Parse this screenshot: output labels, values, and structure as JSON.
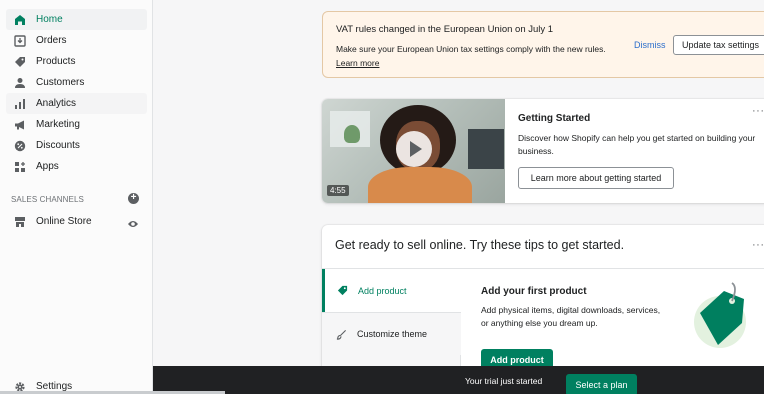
{
  "sidebar": {
    "items": [
      {
        "label": "Home",
        "icon": "home-icon"
      },
      {
        "label": "Orders",
        "icon": "orders-icon"
      },
      {
        "label": "Products",
        "icon": "tag-icon"
      },
      {
        "label": "Customers",
        "icon": "person-icon"
      },
      {
        "label": "Analytics",
        "icon": "bar-chart-icon"
      },
      {
        "label": "Marketing",
        "icon": "megaphone-icon"
      },
      {
        "label": "Discounts",
        "icon": "discount-icon"
      },
      {
        "label": "Apps",
        "icon": "apps-icon"
      }
    ],
    "sales_channels_heading": "SALES CHANNELS",
    "add_channel_symbol": "+",
    "online_store_label": "Online Store",
    "settings_label": "Settings"
  },
  "banner": {
    "title": "VAT rules changed in the European Union on July 1",
    "body": "Make sure your European Union tax settings comply with the new rules.",
    "link": "Learn more",
    "dismiss_label": "Dismiss",
    "update_label": "Update tax settings"
  },
  "getting_started": {
    "duration": "4:55",
    "title": "Getting Started",
    "body": "Discover how Shopify can help you get started on building your business.",
    "button_label": "Learn more about getting started",
    "menu_symbol": "···"
  },
  "tips": {
    "title": "Get ready to sell online. Try these tips to get started.",
    "menu_symbol": "···",
    "tabs": [
      {
        "label": "Add product",
        "icon": "tag-icon"
      },
      {
        "label": "Customize theme",
        "icon": "brush-icon"
      }
    ],
    "panel_title": "Add your first product",
    "panel_body": "Add physical items, digital downloads, services, or anything else you dream up.",
    "panel_button": "Add product"
  },
  "trial": {
    "text": "Your trial just started",
    "button": "Select a plan"
  },
  "colors": {
    "brand_green": "#008060",
    "trial_bar": "#202123",
    "banner_bg": "#fff5ea"
  }
}
